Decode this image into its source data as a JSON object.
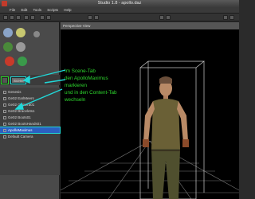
{
  "window": {
    "title": "Studio 1.8 - apollo.daz"
  },
  "menu": [
    "File",
    "Edit",
    "Tools",
    "Scripts",
    "Help"
  ],
  "left_panel": {
    "tabs": [
      "Scene"
    ],
    "scene_items": [
      "Genesis",
      "Ge02 EarlMeers",
      "Ge02 Camera01",
      "Ge02 Bracelets1",
      "Ge02 Boots01",
      "Ge02 BootsHands01",
      "ApolloMaximus",
      "Default Camera"
    ]
  },
  "viewport": {
    "label": "Perspective View"
  },
  "instruction": {
    "lines": [
      "Im Scene-Tab",
      "den ApolloMaximus",
      "markieren",
      "und in den Content-Tab",
      "wechseln"
    ]
  },
  "colors": {
    "annotation": "#21d8d8",
    "instruction_text": "#2ed82e",
    "selection": "#2c5fc1"
  }
}
